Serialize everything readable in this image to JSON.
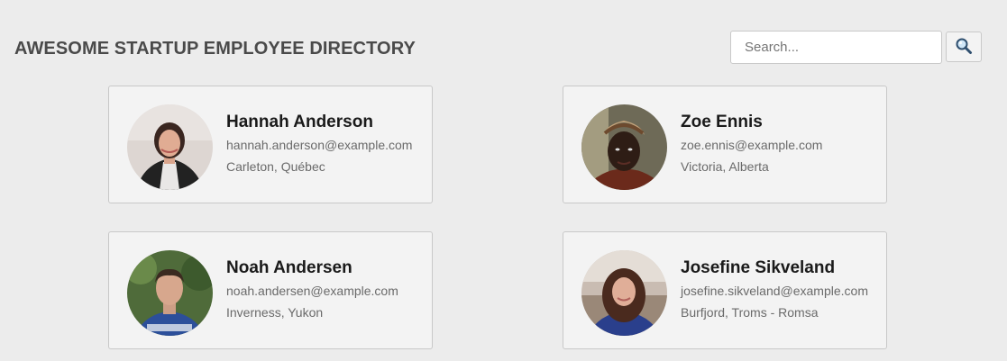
{
  "header": {
    "title": "AWESOME STARTUP EMPLOYEE DIRECTORY"
  },
  "search": {
    "placeholder": "Search...",
    "value": "",
    "button_icon": "magnifier-icon"
  },
  "employees": [
    {
      "name": "Hannah Anderson",
      "email": "hannah.anderson@example.com",
      "location": "Carleton, Québec"
    },
    {
      "name": "Zoe Ennis",
      "email": "zoe.ennis@example.com",
      "location": "Victoria, Alberta"
    },
    {
      "name": "Noah Andersen",
      "email": "noah.andersen@example.com",
      "location": "Inverness, Yukon"
    },
    {
      "name": "Josefine Sikveland",
      "email": "josefine.sikveland@example.com",
      "location": "Burfjord, Troms - Romsa"
    }
  ]
}
